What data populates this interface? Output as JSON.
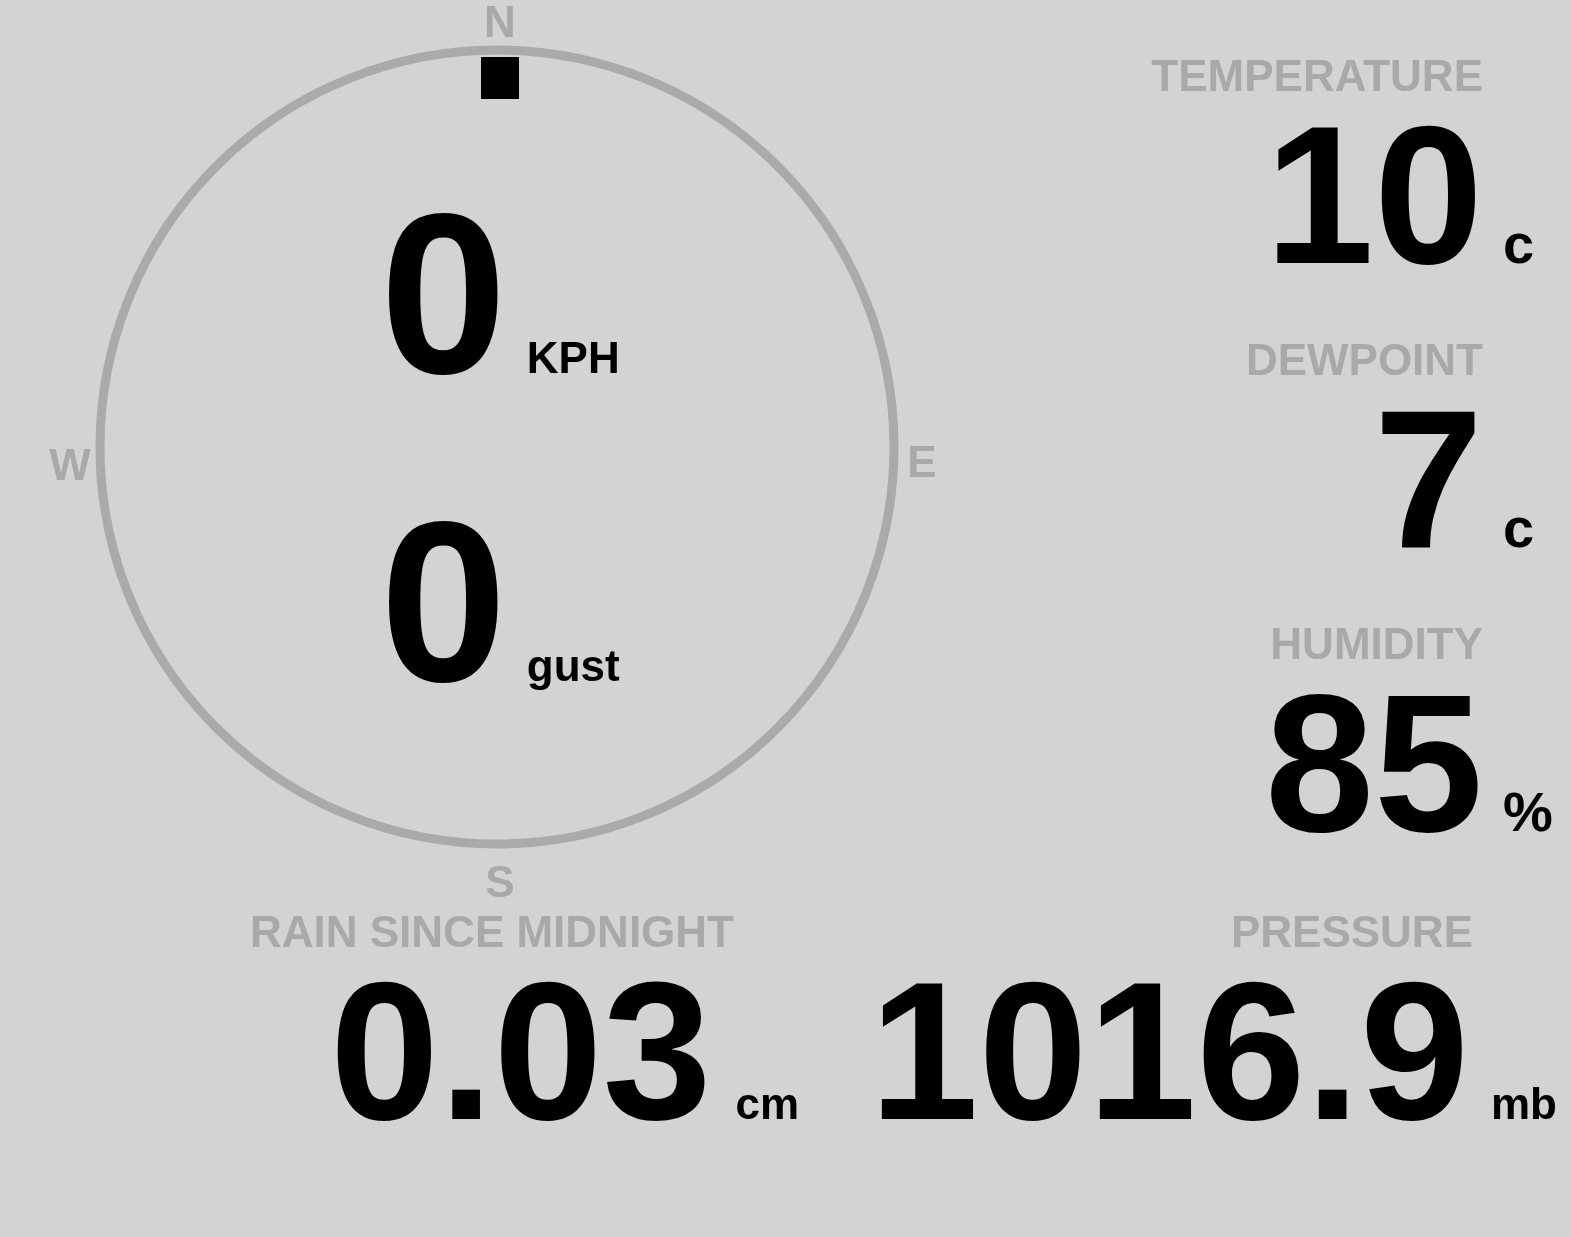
{
  "compass": {
    "labels": [
      {
        "text": "N",
        "kind": "top"
      },
      {
        "text": "E",
        "kind": "right"
      },
      {
        "text": "S",
        "kind": "bottom"
      },
      {
        "text": "W",
        "kind": "left"
      }
    ],
    "wind": [
      {
        "value": "0",
        "unit": "KPH"
      },
      {
        "value": "0",
        "unit": "gust"
      }
    ]
  },
  "readings": [
    {
      "label": "TEMPERATURE",
      "value": "10",
      "unit": "c"
    },
    {
      "label": "DEWPOINT",
      "value": "7",
      "unit": "c"
    },
    {
      "label": "HUMIDITY",
      "value": "85",
      "unit": "%"
    }
  ],
  "rain": {
    "label": "RAIN SINCE MIDNIGHT",
    "value": "0.03",
    "unit": "cm"
  },
  "pressure": {
    "label": "PRESSURE",
    "value": "1016.9",
    "unit": "mb"
  }
}
